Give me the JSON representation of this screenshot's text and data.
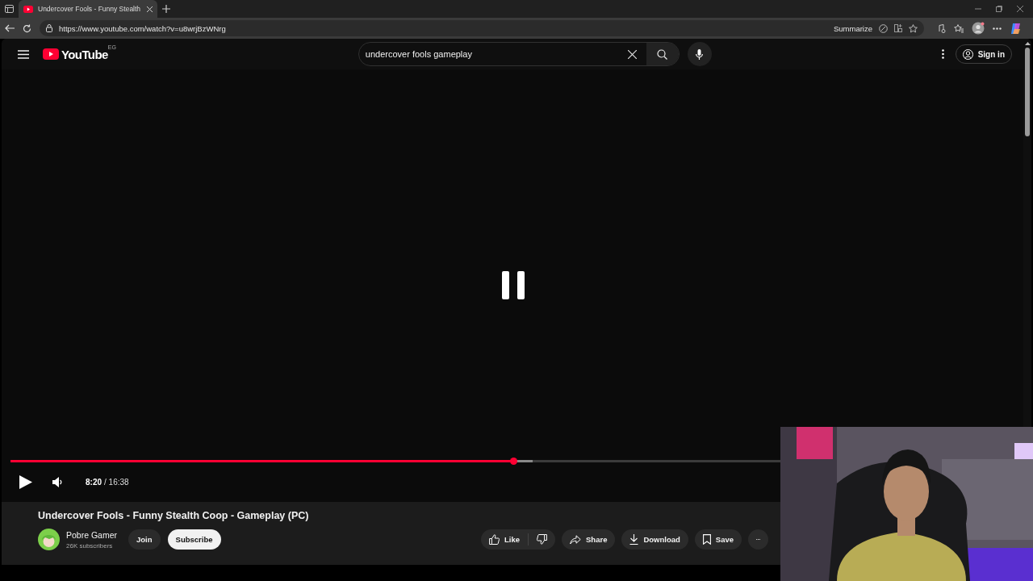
{
  "browser": {
    "tab": {
      "title": "Undercover Fools - Funny Stealth"
    },
    "url": "https://www.youtube.com/watch?v=u8wrjBzWNrg",
    "summarize": "Summarize"
  },
  "header": {
    "logo": "YouTube",
    "region": "EG",
    "search": {
      "value": "undercover fools gameplay"
    },
    "sign_in": "Sign in"
  },
  "player": {
    "paused": true,
    "progress": {
      "level": 0.5
    },
    "buffer": {
      "level": 0.52
    },
    "time_current": "8:20",
    "time_total": "/ 16:38"
  },
  "video": {
    "title": "Undercover Fools - Funny Stealth Coop - Gameplay (PC)",
    "channel": {
      "name": "Pobre Gamer",
      "subscribers": "26K subscribers"
    },
    "join": "Join",
    "subscribe": "Subscribe",
    "actions": [
      {
        "kind": "like",
        "label": "Like"
      },
      {
        "kind": "share",
        "label": "Share"
      },
      {
        "kind": "download",
        "label": "Download"
      },
      {
        "kind": "save",
        "label": "Save"
      }
    ]
  }
}
